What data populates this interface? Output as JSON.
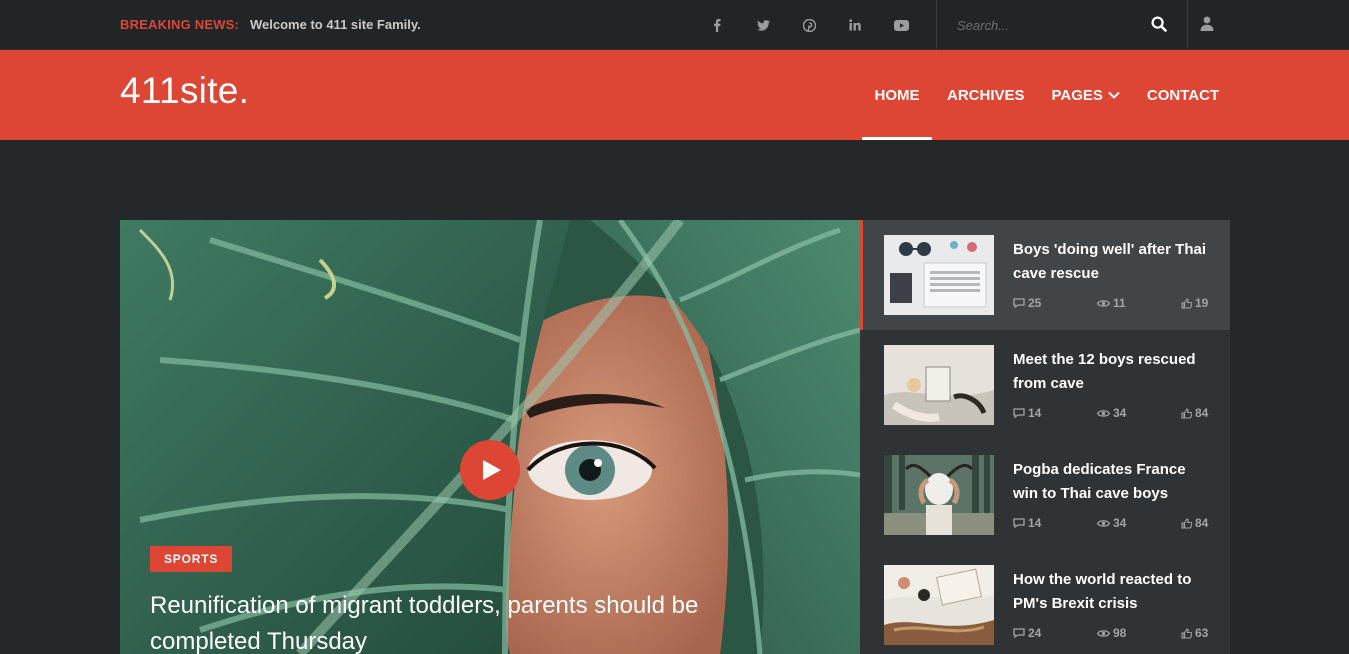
{
  "topbar": {
    "breaking_label": "BREAKING NEWS:",
    "breaking_text": "Welcome to 411 site Family.",
    "socials": [
      "facebook-icon",
      "twitter-icon",
      "pinterest-icon",
      "linkedin-icon",
      "youtube-icon"
    ],
    "search_placeholder": "Search..."
  },
  "header": {
    "logo": "411site.",
    "nav": {
      "home": "HOME",
      "archives": "ARCHIVES",
      "pages": "PAGES",
      "contact": "CONTACT"
    }
  },
  "featured": {
    "category": "SPORTS",
    "title": "Reunification of migrant toddlers, parents should be completed Thursday"
  },
  "posts": [
    {
      "title": "Boys 'doing well' after Thai cave rescue",
      "comments": "25",
      "views": "11",
      "likes": "19"
    },
    {
      "title": "Meet the 12 boys rescued from cave",
      "comments": "14",
      "views": "34",
      "likes": "84"
    },
    {
      "title": "Pogba dedicates France win to Thai cave boys",
      "comments": "14",
      "views": "34",
      "likes": "84"
    },
    {
      "title": "How the world reacted to PM's Brexit crisis",
      "comments": "24",
      "views": "98",
      "likes": "63"
    }
  ],
  "colors": {
    "accent": "#dd4535",
    "topbar": "#222527",
    "page": "#25282a",
    "sidebar": "#303335",
    "sidebar_active": "#424547"
  }
}
